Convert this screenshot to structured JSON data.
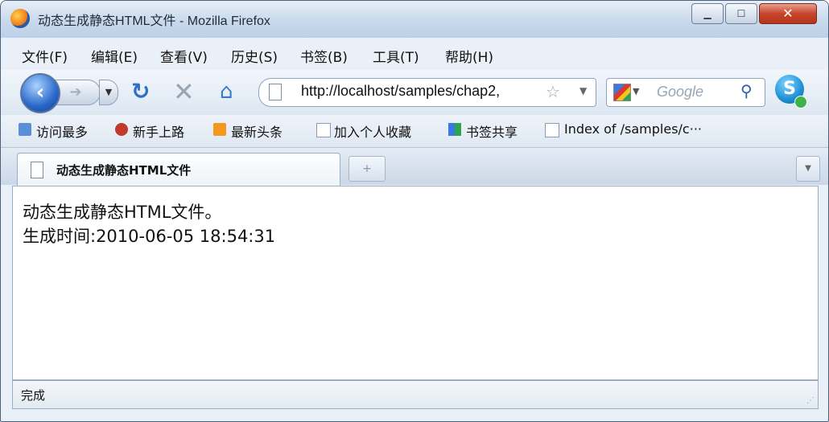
{
  "window": {
    "title": "动态生成静态HTML文件 - Mozilla Firefox"
  },
  "menu": [
    "文件(F)",
    "编辑(E)",
    "查看(V)",
    "历史(S)",
    "书签(B)",
    "工具(T)",
    "帮助(H)"
  ],
  "nav": {
    "url": "http://localhost/samples/chap2,",
    "search_placeholder": "Google"
  },
  "bookmarks": [
    "访问最多",
    "新手上路",
    "最新头条",
    "加入个人收藏",
    "书签共享",
    "Index of /samples/c···"
  ],
  "tab": {
    "title": "动态生成静态HTML文件"
  },
  "page": {
    "line1": "动态生成静态HTML文件。",
    "line2": "生成时间:2010-06-05 18:54:31"
  },
  "status": {
    "text": "完成"
  }
}
